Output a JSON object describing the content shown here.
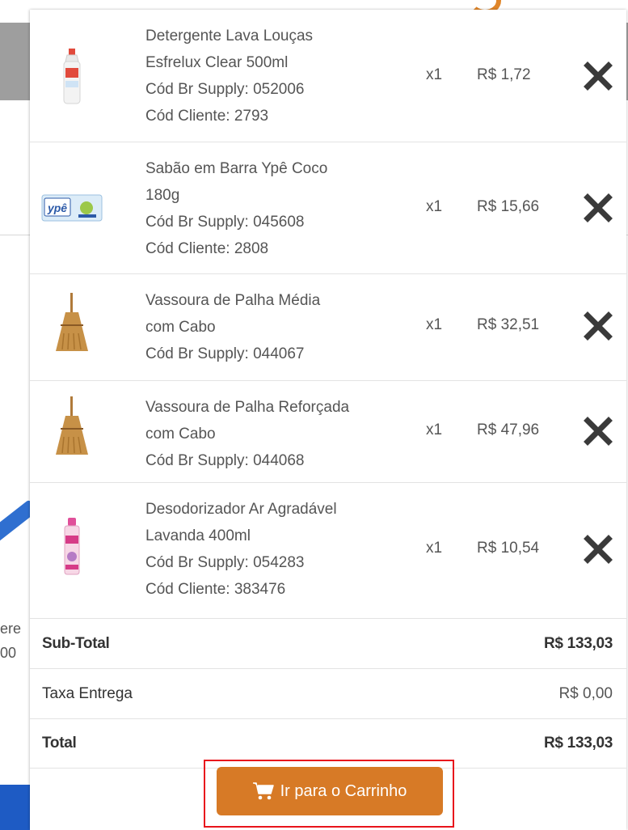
{
  "background": {
    "fragment_lines": [
      "ere",
      "00"
    ]
  },
  "cart": {
    "items": [
      {
        "thumb": "detergent-bottle-icon",
        "desc_lines": [
          "Detergente Lava Louças",
          "Esfrelux Clear 500ml",
          "Cód Br Supply: 052006",
          "Cód Cliente: 2793"
        ],
        "qty": "x1",
        "price": "R$ 1,72"
      },
      {
        "thumb": "soap-bar-icon",
        "thumb_label": "ypê",
        "desc_lines": [
          "Sabão em Barra Ypê Coco",
          "180g",
          "Cód Br Supply: 045608",
          "Cód Cliente: 2808"
        ],
        "qty": "x1",
        "price": "R$ 15,66"
      },
      {
        "thumb": "broom-icon",
        "desc_lines": [
          "Vassoura de Palha Média",
          "com Cabo",
          "Cód Br Supply: 044067"
        ],
        "qty": "x1",
        "price": "R$ 32,51"
      },
      {
        "thumb": "broom-icon",
        "desc_lines": [
          "Vassoura de Palha Reforçada",
          "com Cabo",
          "Cód Br Supply: 044068"
        ],
        "qty": "x1",
        "price": "R$ 47,96"
      },
      {
        "thumb": "air-freshener-icon",
        "desc_lines": [
          "Desodorizador Ar Agradável",
          "Lavanda 400ml",
          "Cód Br Supply: 054283",
          "Cód Cliente: 383476"
        ],
        "qty": "x1",
        "price": "R$ 10,54"
      }
    ],
    "totals": {
      "subtotal_label": "Sub-Total",
      "subtotal_value": "R$ 133,03",
      "delivery_label": "Taxa Entrega",
      "delivery_value": "R$ 0,00",
      "total_label": "Total",
      "total_value": "R$ 133,03"
    },
    "checkout_label": "Ir para o Carrinho"
  },
  "colors": {
    "checkout_button": "#d77a26",
    "highlight_border": "#e8141c",
    "remove_icon": "#3a3a3a"
  }
}
